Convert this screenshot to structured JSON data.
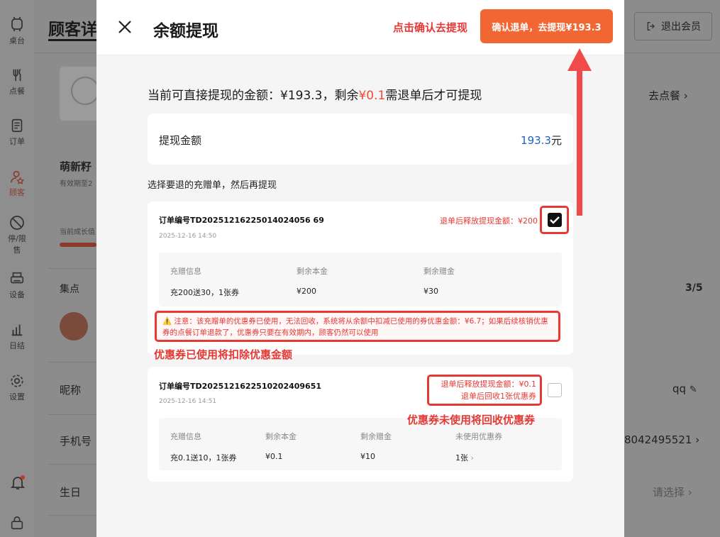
{
  "sidebar": {
    "items": [
      {
        "label": "桌台",
        "icon": "table-icon"
      },
      {
        "label": "点餐",
        "icon": "dining-icon"
      },
      {
        "label": "订单",
        "icon": "order-icon"
      },
      {
        "label": "顾客",
        "icon": "customer-icon"
      },
      {
        "label": "停/限售",
        "icon": "ban-icon"
      },
      {
        "label": "设备",
        "icon": "printer-icon"
      },
      {
        "label": "日结",
        "icon": "chart-icon"
      },
      {
        "label": "设置",
        "icon": "gear-icon"
      }
    ]
  },
  "background": {
    "page_title": "顾客详",
    "exit_button": "退出会员",
    "go_order": "去点餐",
    "member_name": "萌新籽",
    "member_expiry": "有效期至2",
    "growth_label": "当前成长值",
    "stamp_label": "集点",
    "stamp_count": "3/5",
    "nickname_label": "昵称",
    "nickname_value": "qq",
    "phone_label": "手机号",
    "phone_value": "8042495521",
    "birthday_label": "生日",
    "birthday_value": "请选择"
  },
  "modal": {
    "title": "余额提现",
    "hint": "点击确认去提现",
    "confirm_button": "确认退单，去提现¥193.3",
    "summary_pre": "当前可直接提现的金额：¥193.3，剩余",
    "summary_red": "¥0.1",
    "summary_post": "需退单后才可提现",
    "amount_label": "提现金额",
    "amount_value": "193.3",
    "amount_unit": "元",
    "section_label": "选择要退的充赠单，然后再提现"
  },
  "orders": [
    {
      "order_no": "订单编号TD20251216225014024056 69",
      "date": "2025-12-16 14:50",
      "release": "退单后释放提现金额：¥200",
      "checked": true,
      "headers": [
        "充赠信息",
        "剩余本金",
        "剩余赠金"
      ],
      "values": [
        "充200送30，1张券",
        "¥200",
        "¥30"
      ],
      "warning": "⚠️ 注意：该充赠单的优惠券已使用，无法回收，系统将从余额中扣减已使用的券优惠金额：¥6.7；如果后续核销优惠券的点餐订单退款了，优惠券只要在有效期内，顾客仍然可以使用"
    },
    {
      "order_no": "订单编号TD2025121622510202409651",
      "date": "2025-12-16 14:51",
      "release_line1": "退单后释放提现金额：¥0.1",
      "release_line2": "退单后回收1张优惠券",
      "checked": false,
      "headers": [
        "充赠信息",
        "剩余本金",
        "剩余赠金",
        "未使用优惠券"
      ],
      "values": [
        "充0.1送10，1张券",
        "¥0.1",
        "¥10",
        "1张"
      ]
    }
  ],
  "annotations": {
    "deduct": "优惠券已使用将扣除优惠金额",
    "recycle": "优惠券未使用将回收优惠券"
  },
  "colors": {
    "accent": "#f26633",
    "annotation_red": "#e53935",
    "amount_blue": "#1f5fbf"
  }
}
